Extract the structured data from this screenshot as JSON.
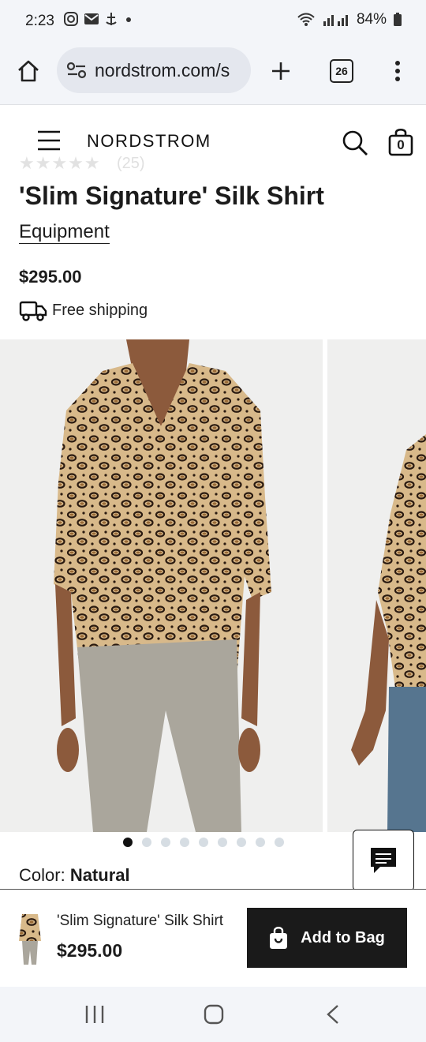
{
  "status_bar": {
    "time": "2:23",
    "battery": "84%"
  },
  "browser": {
    "url": "nordstrom.com/s",
    "tab_count": "26"
  },
  "site": {
    "logo": "NORDSTROM",
    "bag_count": "0"
  },
  "product": {
    "rating_count": "(25)",
    "title": "'Slim Signature' Silk Shirt",
    "brand": "Equipment",
    "price": "$295.00",
    "shipping": "Free shipping",
    "color_label": "Color:",
    "color_value": "Natural"
  },
  "gallery": {
    "image_count": 9,
    "active_index": 0
  },
  "sticky_bar": {
    "name": "'Slim Signature' Silk Shirt",
    "price": "$295.00",
    "add_label": "Add to Bag"
  },
  "colors": {
    "accent": "#1a1a1a",
    "background": "#ffffff",
    "chrome": "#f3f5f9"
  },
  "icons": [
    "home-icon",
    "site-settings-icon",
    "new-tab-icon",
    "tabs-icon",
    "more-icon",
    "menu-icon",
    "search-icon",
    "bag-icon",
    "truck-icon",
    "chat-icon",
    "back-icon",
    "recents-icon",
    "home-nav-icon"
  ]
}
